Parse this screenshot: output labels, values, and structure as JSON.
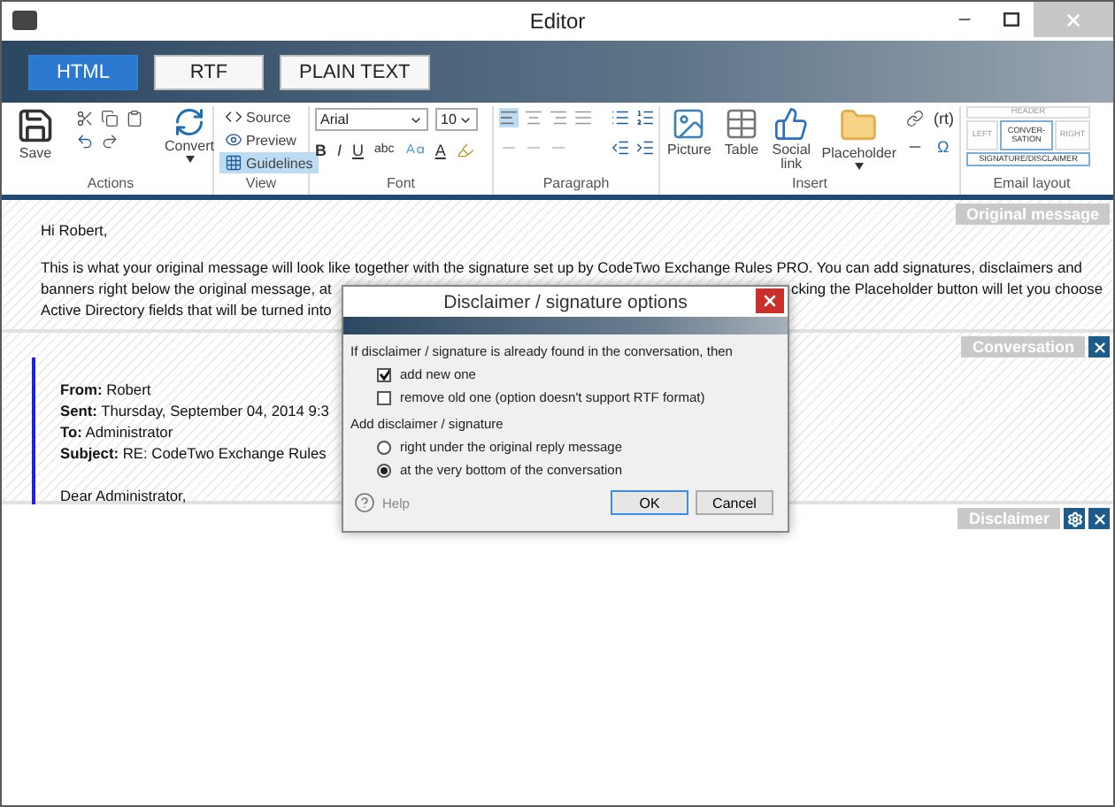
{
  "window": {
    "title": "Editor"
  },
  "format_tabs": [
    {
      "label": "HTML",
      "selected": true
    },
    {
      "label": "RTF",
      "selected": false
    },
    {
      "label": "PLAIN TEXT",
      "selected": false
    }
  ],
  "ribbon": {
    "actions": {
      "label": "Actions",
      "save": "Save",
      "convert": "Convert"
    },
    "view": {
      "label": "View",
      "items": [
        {
          "label": "Source",
          "selected": false
        },
        {
          "label": "Preview",
          "selected": false
        },
        {
          "label": "Guidelines",
          "selected": true
        }
      ]
    },
    "font": {
      "label": "Font",
      "family": "Arial",
      "size": "10",
      "bold": "B",
      "italic": "I",
      "underline": "U",
      "strike": "abc",
      "fore": "A"
    },
    "paragraph": {
      "label": "Paragraph"
    },
    "insert": {
      "label": "Insert",
      "items": [
        "Picture",
        "Table",
        "Social link",
        "Placeholder"
      ],
      "rtl": "(rt)",
      "symbol": "Ω"
    },
    "email_layout": {
      "label": "Email layout",
      "cells": [
        {
          "label": "HEADER",
          "selected": false
        },
        {
          "label": "LEFT",
          "selected": false
        },
        {
          "label": "CONVER-SATION",
          "selected": true
        },
        {
          "label": "RIGHT",
          "selected": false
        },
        {
          "label": "SIGNATURE/DISCLAIMER",
          "selected": true
        }
      ]
    }
  },
  "original_message": {
    "tag": "Original message",
    "greeting": "Hi Robert,",
    "lines": [
      {
        "left": "This is what your original message will look like together with the signature set up by CodeTwo Exchange Rules PRO. You can add signatures, disclaimers and"
      },
      {
        "left": "banners right below the original message, at",
        "right": "cking the Placeholder button will let you choose"
      },
      {
        "left": "Active Directory fields that will be turned into"
      }
    ]
  },
  "conversation": {
    "tag": "Conversation",
    "header": [
      {
        "name": "From:",
        "value": "Robert"
      },
      {
        "name": "Sent:",
        "value": "Thursday, September 04, 2014 9:3"
      },
      {
        "name": "To:",
        "value": "Administrator"
      },
      {
        "name": "Subject:",
        "value": "RE: CodeTwo Exchange Rules"
      }
    ],
    "greeting": "Dear Administrator,"
  },
  "disclaimer": {
    "tag": "Disclaimer"
  },
  "dialog": {
    "title": "Disclaimer / signature options",
    "question": "If disclaimer / signature is already found in the conversation, then",
    "checks": [
      {
        "label": "add new one",
        "checked": true
      },
      {
        "label": "remove old one (option doesn't support RTF format)",
        "checked": false
      }
    ],
    "group_label": "Add disclaimer / signature",
    "options": [
      {
        "label": "right under the original reply message",
        "selected": false
      },
      {
        "label": "at the very bottom of the conversation",
        "selected": true
      }
    ],
    "help": "Help",
    "buttons": [
      "OK",
      "Cancel"
    ]
  }
}
